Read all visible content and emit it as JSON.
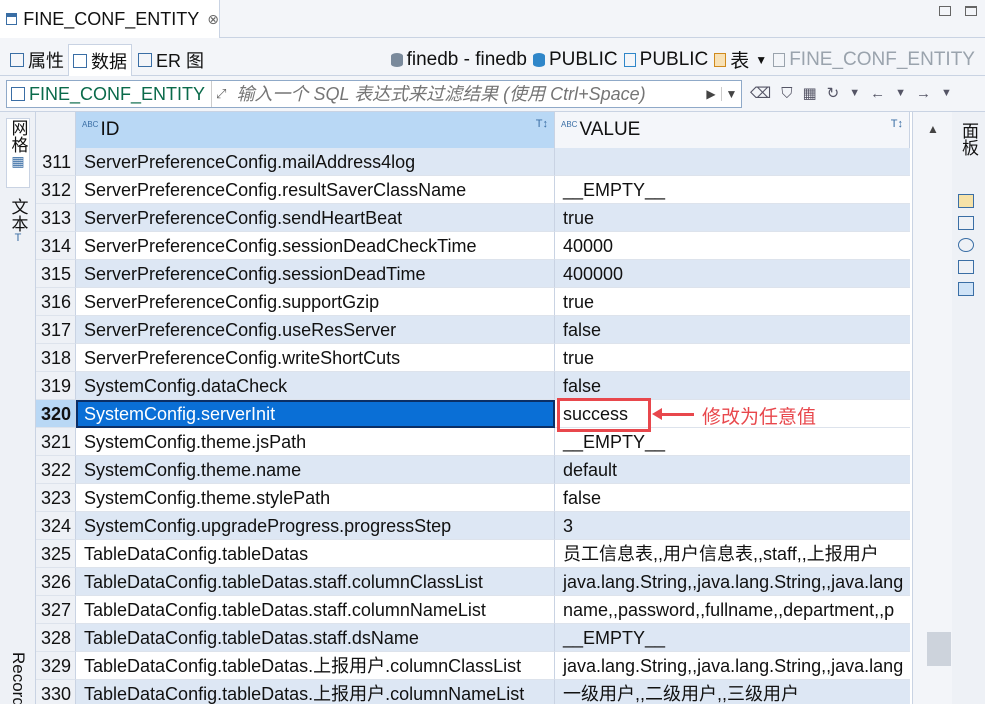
{
  "tab": {
    "title": "FINE_CONF_ENTITY",
    "close": "⊗"
  },
  "subtabs": [
    {
      "label": "属性"
    },
    {
      "label": "数据"
    },
    {
      "label": "ER 图"
    }
  ],
  "breadcrumb": {
    "datasource": "finedb - finedb",
    "schema1": "PUBLIC",
    "schema2": "PUBLIC",
    "type": "表",
    "entity": "FINE_CONF_ENTITY"
  },
  "filter": {
    "entity": "FINE_CONF_ENTITY",
    "placeholder": "输入一个 SQL 表达式来过滤结果 (使用 Ctrl+Space)"
  },
  "left_tabs": {
    "grid": "网格",
    "text": "文本",
    "record": "Record"
  },
  "right_tabs": {
    "panels": "面板"
  },
  "columns": [
    {
      "label": "ID",
      "type_tag": "ABC"
    },
    {
      "label": "VALUE",
      "type_tag": "ABC"
    }
  ],
  "rows": [
    {
      "num": "311",
      "id": "ServerPreferenceConfig.mailAddress4log",
      "value": ""
    },
    {
      "num": "312",
      "id": "ServerPreferenceConfig.resultSaverClassName",
      "value": "__EMPTY__"
    },
    {
      "num": "313",
      "id": "ServerPreferenceConfig.sendHeartBeat",
      "value": "true"
    },
    {
      "num": "314",
      "id": "ServerPreferenceConfig.sessionDeadCheckTime",
      "value": "40000"
    },
    {
      "num": "315",
      "id": "ServerPreferenceConfig.sessionDeadTime",
      "value": "400000"
    },
    {
      "num": "316",
      "id": "ServerPreferenceConfig.supportGzip",
      "value": "true"
    },
    {
      "num": "317",
      "id": "ServerPreferenceConfig.useResServer",
      "value": "false"
    },
    {
      "num": "318",
      "id": "ServerPreferenceConfig.writeShortCuts",
      "value": "true"
    },
    {
      "num": "319",
      "id": "SystemConfig.dataCheck",
      "value": "false"
    },
    {
      "num": "320",
      "id": "SystemConfig.serverInit",
      "value": "success"
    },
    {
      "num": "321",
      "id": "SystemConfig.theme.jsPath",
      "value": "__EMPTY__"
    },
    {
      "num": "322",
      "id": "SystemConfig.theme.name",
      "value": "default"
    },
    {
      "num": "323",
      "id": "SystemConfig.theme.stylePath",
      "value": "false"
    },
    {
      "num": "324",
      "id": "SystemConfig.upgradeProgress.progressStep",
      "value": "3"
    },
    {
      "num": "325",
      "id": "TableDataConfig.tableDatas",
      "value": "员工信息表,,用户信息表,,staff,,上报用户"
    },
    {
      "num": "326",
      "id": "TableDataConfig.tableDatas.staff.columnClassList",
      "value": "java.lang.String,,java.lang.String,,java.lang"
    },
    {
      "num": "327",
      "id": "TableDataConfig.tableDatas.staff.columnNameList",
      "value": "name,,password,,fullname,,department,,p"
    },
    {
      "num": "328",
      "id": "TableDataConfig.tableDatas.staff.dsName",
      "value": "__EMPTY__"
    },
    {
      "num": "329",
      "id": "TableDataConfig.tableDatas.上报用户.columnClassList",
      "value": "java.lang.String,,java.lang.String,,java.lang"
    },
    {
      "num": "330",
      "id": "TableDataConfig.tableDatas.上报用户.columnNameList",
      "value": "一级用户,,二级用户,,三级用户"
    }
  ],
  "annotation": {
    "text": "修改为任意值",
    "color": "#e8474c"
  }
}
